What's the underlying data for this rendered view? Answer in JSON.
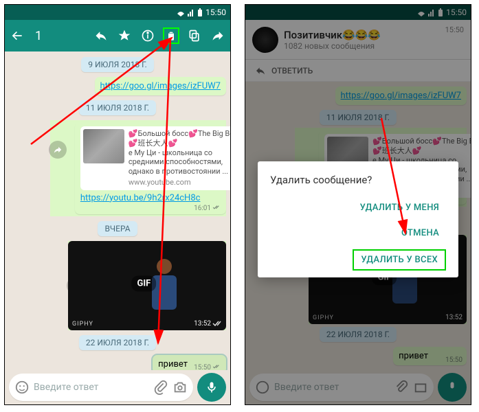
{
  "status": {
    "time": "15:50"
  },
  "selection": {
    "count": "1"
  },
  "dates": {
    "d1": "9 ИЮЛЯ 2018 Г.",
    "d2": "11 ИЮЛЯ 2018 Г.",
    "d3": "ВЧЕРА",
    "d4": "22 ИЮЛЯ 2018 Г."
  },
  "messages": {
    "link1": "https://goo.gl/images/izFUW7",
    "yt_title": "💕Большой босс💕The Big Boss💕班长大人💕",
    "yt_desc": "е Му Ци - школьница со средними способностями, однако в противостоянии ...",
    "yt_domain": "www.youtube.com",
    "yt_link": "https://youtu.be/9h2rx24cH8c",
    "yt_time": "16:01",
    "gif_label": "GIF",
    "gif_brand": "GIPHY",
    "gif_time": "13:52",
    "hello": "привет",
    "hello_time": "15:50"
  },
  "input": {
    "placeholder": "Введите ответ"
  },
  "right_header": {
    "title": "Позитивчик",
    "emoji": "😂😂😂",
    "sub": "1082 новых сообщения",
    "time": "15:50",
    "reply": "ОТВЕТИТЬ"
  },
  "dialog": {
    "title": "Удалить сообщение?",
    "opt_me": "УДАЛИТЬ У МЕНЯ",
    "opt_cancel": "ОТМЕНА",
    "opt_all": "УДАЛИТЬ У ВСЕХ"
  }
}
